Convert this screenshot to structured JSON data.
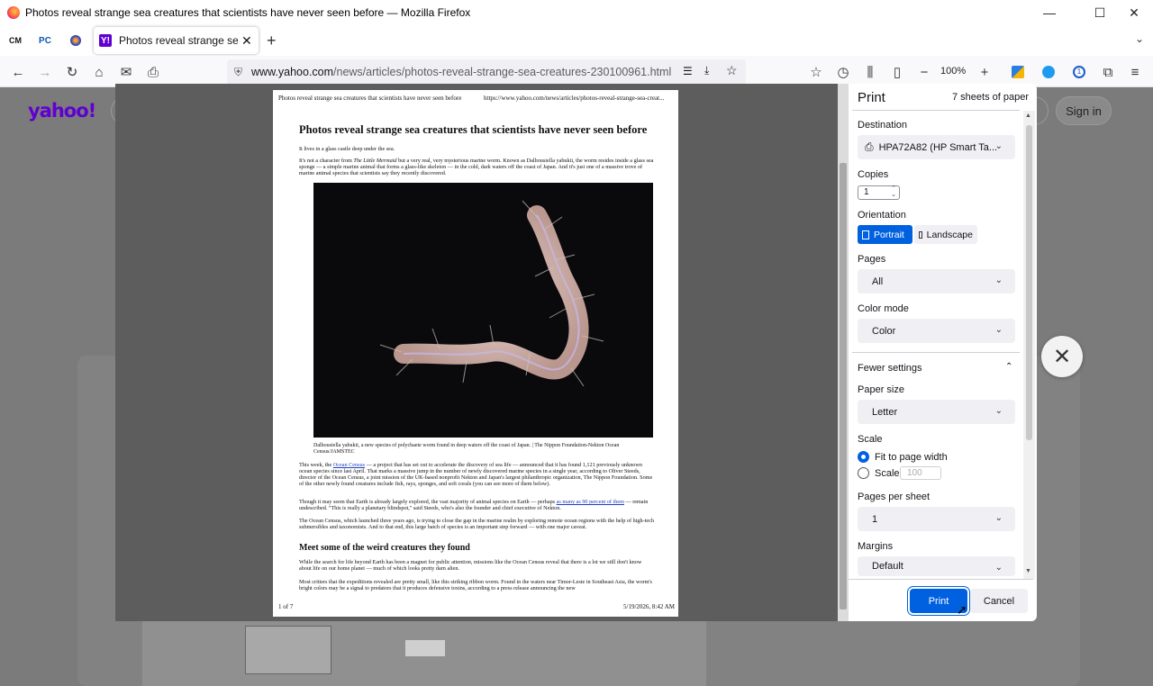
{
  "window": {
    "title": "Photos reveal strange sea creatures that scientists have never seen before — Mozilla Firefox",
    "minimize": "—",
    "maximize": "☐",
    "close": "✕"
  },
  "tabs": {
    "pinned": [
      {
        "label": "CM",
        "icon": "cm-favicon"
      },
      {
        "label": "PC",
        "icon": "pc-favicon"
      },
      {
        "label": "",
        "icon": "round-favicon"
      }
    ],
    "active": {
      "label": "Photos reveal strange sea creat",
      "favicon": "Y!",
      "close": "✕"
    },
    "new_tab": "+",
    "list_all": "⌄"
  },
  "navbar": {
    "url_host": "www.yahoo.com",
    "url_path": "/news/articles/photos-reveal-strange-sea-creatures-230100961.html",
    "zoom": "100%"
  },
  "site": {
    "logo": "yahoo!",
    "signin": "Sign in",
    "close_overlay": "✕"
  },
  "preview": {
    "header_left": "Photos reveal strange sea creatures that scientists have never seen before",
    "header_right": "https://www.yahoo.com/news/articles/photos-reveal-strange-sea-creat...",
    "title": "Photos reveal strange sea creatures that scientists have never seen before",
    "lede": "It lives in a glass castle deep under the sea.",
    "p1_a": "It's not a character from ",
    "p1_em": "The Little Mermaid",
    "p1_b": " but a very real, very mysterious marine worm. Known as Dalhousiella yabukii, the worm resides inside a glass sea sponge — a simple marine animal that forms a glass-like skeleton — in the cold, dark waters off the coast of Japan. And it's just one of a massive trove of marine animal species that scientists say they recently discovered.",
    "caption": "Dalhousiella yabukii, a new species of polychaete worm found in deep waters off the coast of Japan. | The Nippon Foundation-Nekton Ocean Census/JAMSTEC",
    "p2_a": "This week, the ",
    "p2_link": "Ocean Census",
    "p2_b": " — a project that has set out to accelerate the discovery of sea life — announced that it has found 1,121 previously unknown ocean species since last April. That marks a massive jump in the number of newly discovered marine species in a single year, according to Oliver Steeds, director of the Ocean Census, a joint mission of the UK-based nonprofit Nekton and Japan's largest philanthropic organization, The Nippon Foundation. Some of the other newly found creatures include fish, rays, sponges, and soft corals (you can see more of them below).",
    "p3_a": "Though it may seem that Earth is already largely explored, the vast majority of animal species on Earth — perhaps ",
    "p3_link": "as many as 90 percent of them",
    "p3_b": " — remain undescribed. \"This is really a planetary blindspot,\" said Steeds, who's also the founder and chief executive of Nekton.",
    "p4": "The Ocean Census, which launched three years ago, is trying to close the gap in the marine realm by exploring remote ocean regions with the help of high-tech submersibles and taxonomists. And to that end, this large batch of species is an important step forward — with one major caveat.",
    "h2": "Meet some of the weird creatures they found",
    "p5": "While the search for life beyond Earth has been a magnet for public attention, missions like the Ocean Census reveal that there is a lot we still don't know about life on our home planet — much of which looks pretty darn alien.",
    "p6": "Most critters that the expeditions revealed are pretty small, like this striking ribbon worm. Found in the waters near Timor-Leste in Southeast Asia, the worm's bright colors may be a signal to predators that it produces defensive toxins, according to a press release announcing the new",
    "footer_left": "1 of 7",
    "footer_right": "5/19/2026, 8:42 AM"
  },
  "print": {
    "title": "Print",
    "sheets": "7 sheets of paper",
    "destination_label": "Destination",
    "destination_value": "HPA72A82 (HP Smart Ta...",
    "copies_label": "Copies",
    "copies_value": "1",
    "orientation_label": "Orientation",
    "portrait": "Portrait",
    "landscape": "Landscape",
    "pages_label": "Pages",
    "pages_value": "All",
    "color_label": "Color mode",
    "color_value": "Color",
    "fewer_settings": "Fewer settings",
    "paper_label": "Paper size",
    "paper_value": "Letter",
    "scale_label": "Scale",
    "fit_to_width": "Fit to page width",
    "scale_option": "Scale",
    "scale_value": "100",
    "pps_label": "Pages per sheet",
    "pps_value": "1",
    "margins_label": "Margins",
    "margins_value": "Default",
    "print_btn": "Print",
    "cancel_btn": "Cancel"
  }
}
